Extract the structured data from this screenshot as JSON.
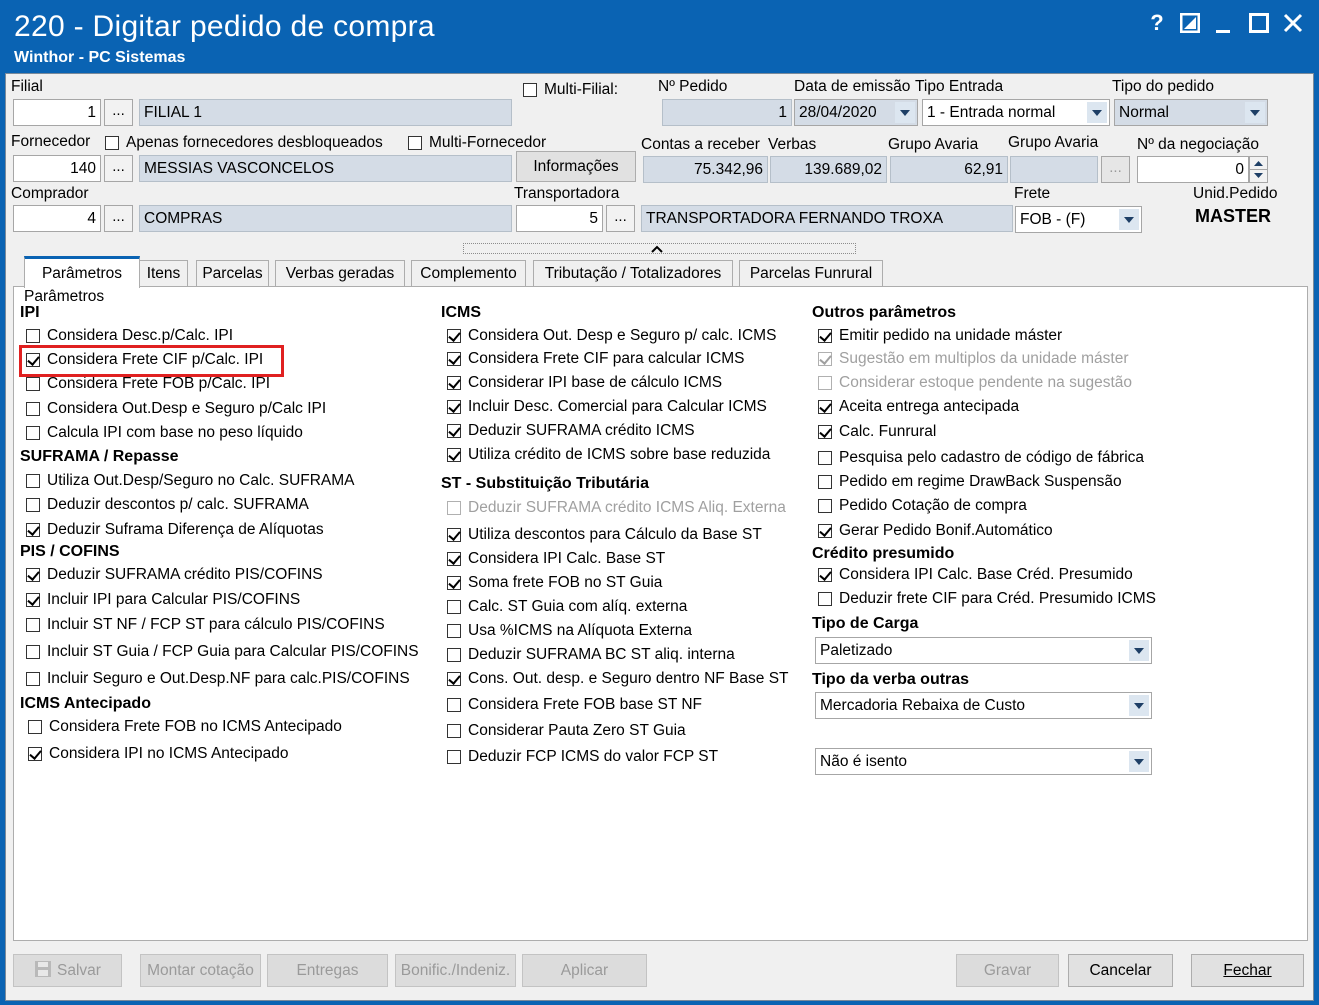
{
  "window": {
    "title": "220 - Digitar pedido de compra",
    "subtitle": "Winthor - PC Sistemas",
    "controls": [
      "?",
      "▣",
      "_",
      "☐",
      "✕"
    ]
  },
  "header": {
    "filial_label": "Filial",
    "filial_code": "1",
    "filial_name": "FILIAL 1",
    "multi_filial_label": "Multi-Filial:",
    "numero_pedido_label": "Nº Pedido",
    "numero_pedido": "1",
    "data_emissao_label": "Data de emissão",
    "data_emissao": "28/04/2020",
    "tipo_entrada_label": "Tipo Entrada",
    "tipo_entrada": "1 - Entrada normal",
    "tipo_pedido_label": "Tipo do pedido",
    "tipo_pedido": "Normal",
    "fornecedor_label": "Fornecedor",
    "apenas_desbloqueados_label": "Apenas fornecedores desbloqueados",
    "multi_fornecedor_label": "Multi-Fornecedor",
    "fornecedor_code": "140",
    "fornecedor_name": "MESSIAS VASCONCELOS",
    "informacoes_label": "Informações",
    "contas_receber_label": "Contas a receber",
    "contas_receber": "75.342,96",
    "verbas_label": "Verbas",
    "verbas": "139.689,02",
    "grupo_avaria_label": "Grupo Avaria",
    "grupo_avaria": "62,91",
    "grupo_avaria2_label": "Grupo Avaria",
    "grupo_avaria2": "",
    "negociacao_label": "Nº da negociação",
    "negociacao": "0",
    "comprador_label": "Comprador",
    "comprador_code": "4",
    "comprador_name": "COMPRAS",
    "transportadora_label": "Transportadora",
    "transportadora_code": "5",
    "transportadora_name": "TRANSPORTADORA FERNANDO TROXA",
    "frete_label": "Frete",
    "frete": "FOB - (F)",
    "unid_pedido_label": "Unid.Pedido",
    "unid_pedido": "MASTER",
    "dots": "..."
  },
  "tabs": [
    "Parâmetros",
    "Itens",
    "Parcelas",
    "Verbas geradas",
    "Complemento",
    "Tributação / Totalizadores",
    "Parcelas Funrural"
  ],
  "panel_title": "Parâmetros",
  "col1": {
    "ipi_title": "IPI",
    "ipi": [
      {
        "label": "Considera Desc.p/Calc. IPI",
        "checked": false
      },
      {
        "label": "Considera Frete CIF p/Calc. IPI",
        "checked": true
      },
      {
        "label": "Considera Frete FOB p/Calc. IPI",
        "checked": false
      },
      {
        "label": "Considera Out.Desp e Seguro p/Calc IPI",
        "checked": false
      },
      {
        "label": "Calcula IPI com base no peso líquido",
        "checked": false
      }
    ],
    "suframa_title": "SUFRAMA / Repasse",
    "suframa": [
      {
        "label": "Utiliza Out.Desp/Seguro no Calc. SUFRAMA",
        "checked": false
      },
      {
        "label": "Deduzir descontos p/ calc. SUFRAMA",
        "checked": false
      },
      {
        "label": "Deduzir Suframa Diferença de Alíquotas",
        "checked": true
      }
    ],
    "pis_title": "PIS / COFINS",
    "pis": [
      {
        "label": "Deduzir SUFRAMA crédito PIS/COFINS",
        "checked": true
      },
      {
        "label": "Incluir IPI para Calcular PIS/COFINS",
        "checked": true
      },
      {
        "label": "Incluir ST NF / FCP ST para cálculo PIS/COFINS",
        "checked": false
      },
      {
        "label": "Incluir ST Guia / FCP Guia para Calcular PIS/COFINS",
        "checked": false
      },
      {
        "label": "Incluir Seguro e Out.Desp.NF para calc.PIS/COFINS",
        "checked": false
      }
    ],
    "icms_ant_title": "ICMS Antecipado",
    "icms_ant": [
      {
        "label": "Considera Frete FOB no ICMS Antecipado",
        "checked": false
      },
      {
        "label": "Considera IPI no ICMS Antecipado",
        "checked": true
      }
    ]
  },
  "col2": {
    "icms_title": "ICMS",
    "icms": [
      {
        "label": "Considera Out. Desp e Seguro p/ calc. ICMS",
        "checked": true
      },
      {
        "label": "Considera Frete CIF para calcular ICMS",
        "checked": true
      },
      {
        "label": "Considerar IPI base de cálculo ICMS",
        "checked": true
      },
      {
        "label": "Incluir Desc. Comercial  para Calcular ICMS",
        "checked": true
      },
      {
        "label": "Deduzir SUFRAMA crédito ICMS",
        "checked": true
      },
      {
        "label": "Utiliza crédito de ICMS sobre base reduzida",
        "checked": true
      }
    ],
    "st_title": "ST - Substituição Tributária",
    "st": [
      {
        "label": "Deduzir SUFRAMA crédito ICMS Aliq. Externa",
        "checked": false,
        "disabled": true
      },
      {
        "label": "Utiliza descontos para Cálculo da Base ST",
        "checked": true
      },
      {
        "label": "Considera IPI Calc. Base ST",
        "checked": true
      },
      {
        "label": "Soma frete FOB no ST Guia",
        "checked": true
      },
      {
        "label": "Calc. ST Guia com alíq. externa",
        "checked": false
      },
      {
        "label": "Usa %ICMS na Alíquota Externa",
        "checked": false
      },
      {
        "label": "Deduzir SUFRAMA BC ST aliq. interna",
        "checked": false
      },
      {
        "label": "Cons. Out. desp. e Seguro dentro NF Base ST",
        "checked": true
      },
      {
        "label": "Considera Frete FOB base ST NF",
        "checked": false
      },
      {
        "label": "Considerar Pauta Zero ST Guia",
        "checked": false
      },
      {
        "label": "Deduzir FCP ICMS do valor FCP ST",
        "checked": false
      }
    ]
  },
  "col3": {
    "outros_title": "Outros parâmetros",
    "outros": [
      {
        "label": "Emitir pedido na unidade máster",
        "checked": true
      },
      {
        "label": "Sugestão em multiplos da unidade máster",
        "checked": true,
        "disabled": true
      },
      {
        "label": "Considerar estoque pendente na sugestão",
        "checked": false,
        "disabled": true
      },
      {
        "label": "Aceita entrega antecipada",
        "checked": true
      },
      {
        "label": "Calc. Funrural",
        "checked": true
      },
      {
        "label": "Pesquisa pelo cadastro de código de fábrica",
        "checked": false
      },
      {
        "label": "Pedido em regime DrawBack Suspensão",
        "checked": false
      },
      {
        "label": "Pedido Cotação de compra",
        "checked": false
      },
      {
        "label": "Gerar Pedido Bonif.Automático",
        "checked": true
      }
    ],
    "credito_title": "Crédito presumido",
    "credito": [
      {
        "label": "Considera IPI Calc. Base Créd. Presumido",
        "checked": true
      },
      {
        "label": "Deduzir frete CIF para Créd. Presumido ICMS",
        "checked": false
      }
    ],
    "tipo_carga_title": "Tipo de Carga",
    "tipo_carga": "Paletizado",
    "tipo_verba_title": "Tipo da verba outras",
    "tipo_verba": "Mercadoria Rebaixa de Custo",
    "isencao": "Não é isento"
  },
  "footer": {
    "salvar": "Salvar",
    "montar_cotacao": "Montar cotação",
    "entregas": "Entregas",
    "bonific": "Bonific./Indeniz.",
    "aplicar": "Aplicar",
    "gravar": "Gravar",
    "cancelar": "Cancelar",
    "fechar": "Fechar"
  },
  "colors": {
    "title_bar": "#0a63b3",
    "highlight": "#e02020",
    "tab_accent": "#0a63b3"
  }
}
